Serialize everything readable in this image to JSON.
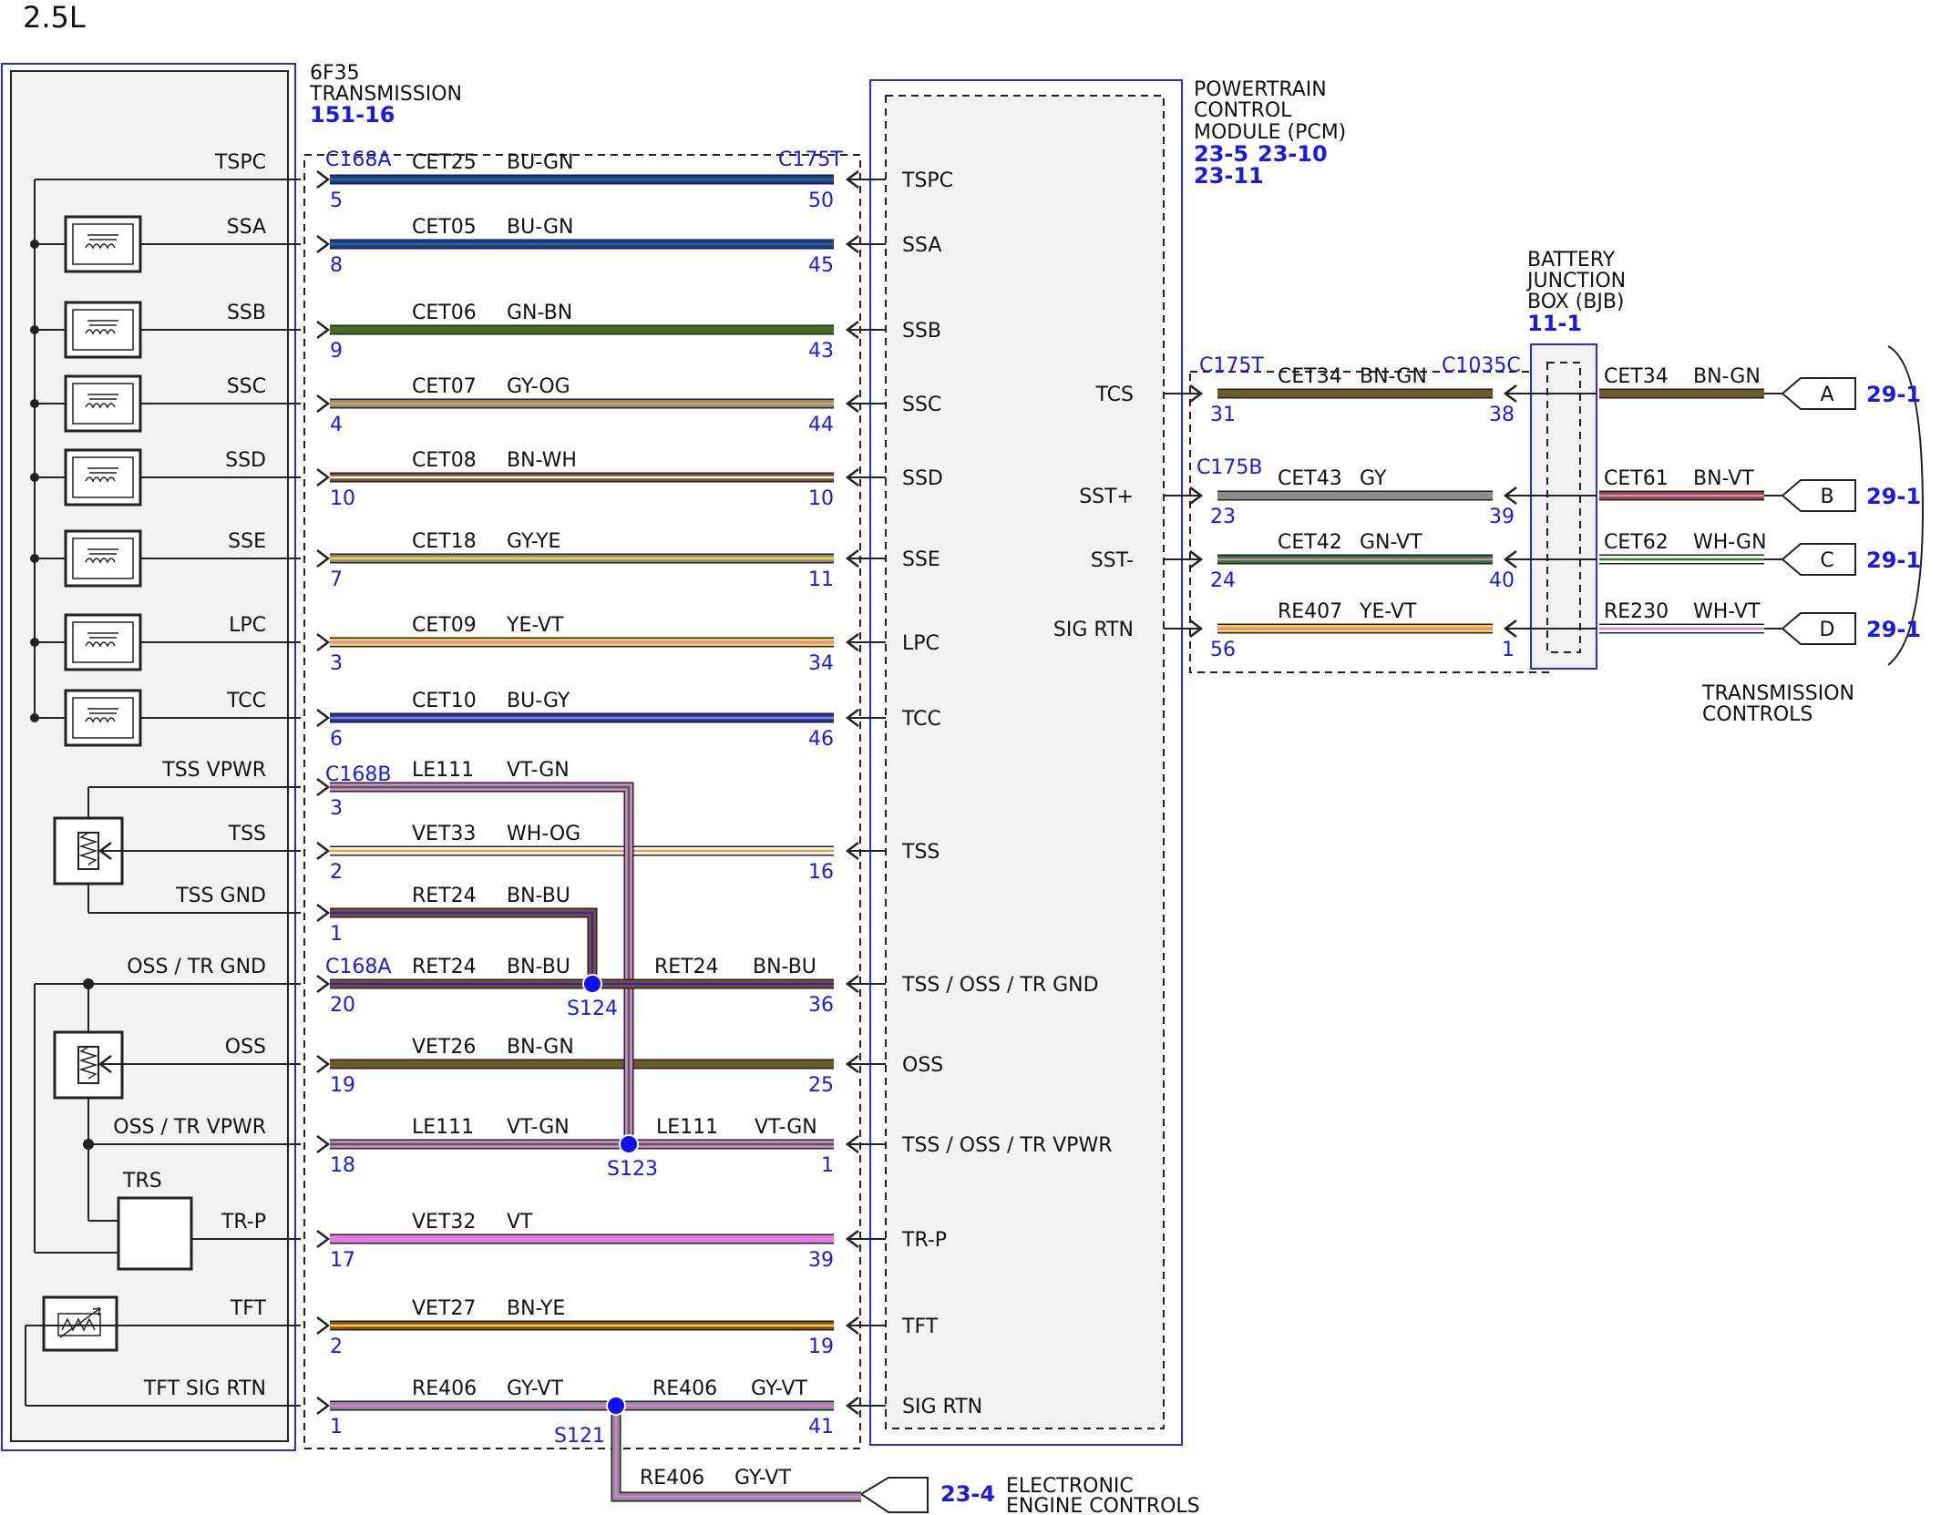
{
  "engine_label": "2.5L",
  "transmission": {
    "name_line1": "6F35",
    "name_line2": "TRANSMISSION",
    "ref": "151-16"
  },
  "pcm": {
    "line1": "POWERTRAIN",
    "line2": "CONTROL",
    "line3": "MODULE (PCM)",
    "ref1": "23-5",
    "ref2": "23-10",
    "ref3": "23-11"
  },
  "bjb": {
    "line1": "BATTERY",
    "line2": "JUNCTION",
    "line3": "BOX (BJB)",
    "ref": "11-1"
  },
  "transmission_controls": {
    "line1": "TRANSMISSION",
    "line2": "CONTROLS"
  },
  "electronic_engine_controls": {
    "ref": "23-4",
    "line1": "ELECTRONIC",
    "line2": "ENGINE CONTROLS"
  },
  "connectors": {
    "c168a_top": "C168A",
    "c175t_top": "C175T",
    "c168b": "C168B",
    "c168a_mid": "C168A",
    "c175t_right": "C175T",
    "c1035c": "C1035C",
    "c175b": "C175B"
  },
  "splices": {
    "s124": "S124",
    "s123": "S123",
    "s121": "S121"
  },
  "left_circuits": [
    {
      "left_label": "TSPC",
      "pin_left": "5",
      "circuit": "CET25",
      "color": "BU-GN",
      "pin_right": "50",
      "pcm_label": "TSPC"
    },
    {
      "left_label": "SSA",
      "pin_left": "8",
      "circuit": "CET05",
      "color": "BU-GN",
      "pin_right": "45",
      "pcm_label": "SSA"
    },
    {
      "left_label": "SSB",
      "pin_left": "9",
      "circuit": "CET06",
      "color": "GN-BN",
      "pin_right": "43",
      "pcm_label": "SSB"
    },
    {
      "left_label": "SSC",
      "pin_left": "4",
      "circuit": "CET07",
      "color": "GY-OG",
      "pin_right": "44",
      "pcm_label": "SSC"
    },
    {
      "left_label": "SSD",
      "pin_left": "10",
      "circuit": "CET08",
      "color": "BN-WH",
      "pin_right": "10",
      "pcm_label": "SSD"
    },
    {
      "left_label": "SSE",
      "pin_left": "7",
      "circuit": "CET18",
      "color": "GY-YE",
      "pin_right": "11",
      "pcm_label": "SSE"
    },
    {
      "left_label": "LPC",
      "pin_left": "3",
      "circuit": "CET09",
      "color": "YE-VT",
      "pin_right": "34",
      "pcm_label": "LPC"
    },
    {
      "left_label": "TCC",
      "pin_left": "6",
      "circuit": "CET10",
      "color": "BU-GY",
      "pin_right": "46",
      "pcm_label": "TCC"
    },
    {
      "left_label": "TSS VPWR",
      "pin_left": "3",
      "circuit": "LE111",
      "color": "VT-GN",
      "pin_right": "",
      "pcm_label": ""
    },
    {
      "left_label": "TSS",
      "pin_left": "2",
      "circuit": "VET33",
      "color": "WH-OG",
      "pin_right": "16",
      "pcm_label": "TSS"
    },
    {
      "left_label": "TSS GND",
      "pin_left": "1",
      "circuit": "RET24",
      "color": "BN-BU",
      "pin_right": "",
      "pcm_label": ""
    },
    {
      "left_label": "OSS / TR GND",
      "pin_left": "20",
      "circuit": "RET24",
      "color": "BN-BU",
      "circuit2": "RET24",
      "color2": "BN-BU",
      "pin_right": "36",
      "pcm_label": "TSS / OSS / TR GND"
    },
    {
      "left_label": "OSS",
      "pin_left": "19",
      "circuit": "VET26",
      "color": "BN-GN",
      "pin_right": "25",
      "pcm_label": "OSS"
    },
    {
      "left_label": "OSS / TR VPWR",
      "pin_left": "18",
      "circuit": "LE111",
      "color": "VT-GN",
      "circuit2": "LE111",
      "color2": "VT-GN",
      "pin_right": "1",
      "pcm_label": "TSS / OSS / TR VPWR"
    },
    {
      "left_label": "TR-P",
      "pin_left": "17",
      "circuit": "VET32",
      "color": "VT",
      "pin_right": "39",
      "pcm_label": "TR-P"
    },
    {
      "left_label": "TFT",
      "pin_left": "2",
      "circuit": "VET27",
      "color": "BN-YE",
      "pin_right": "19",
      "pcm_label": "TFT"
    },
    {
      "left_label": "TFT SIG RTN",
      "pin_left": "1",
      "circuit": "RE406",
      "color": "GY-VT",
      "circuit2": "RE406",
      "color2": "GY-VT",
      "pin_right": "41",
      "pcm_label": "SIG RTN"
    }
  ],
  "trs_label": "TRS",
  "bottom_branch": {
    "circuit": "RE406",
    "color": "GY-VT"
  },
  "right_circuits": [
    {
      "pcm_label": "TCS",
      "pin_left": "31",
      "circuit": "CET34",
      "color": "BN-GN",
      "pin_right": "38",
      "circuit2": "CET34",
      "color2": "BN-GN",
      "ref_letter": "A",
      "ref": "29-1"
    },
    {
      "pcm_label": "SST+",
      "pin_left": "23",
      "circuit": "CET43",
      "color": "GY",
      "pin_right": "39",
      "circuit2": "CET61",
      "color2": "BN-VT",
      "ref_letter": "B",
      "ref": "29-1"
    },
    {
      "pcm_label": "SST-",
      "pin_left": "24",
      "circuit": "CET42",
      "color": "GN-VT",
      "pin_right": "40",
      "circuit2": "CET62",
      "color2": "WH-GN",
      "ref_letter": "C",
      "ref": "29-1"
    },
    {
      "pcm_label": "SIG RTN",
      "pin_left": "56",
      "circuit": "RE407",
      "color": "YE-VT",
      "pin_right": "1",
      "circuit2": "RE230",
      "color2": "WH-VT",
      "ref_letter": "D",
      "ref": "29-1"
    }
  ],
  "colors": {
    "BU": "#1a2ec8",
    "GN": "#2a7a1e",
    "BN": "#8a4a2a",
    "GY": "#8c8c8c",
    "OG": "#e8a23a",
    "WH": "#ffffff",
    "YE": "#f2d72a",
    "VT": "#e07ae0",
    "outline": "#222222",
    "blue_text": "#1a1ae6",
    "splice": "#1010ee",
    "box_fill": "#f2f2f2",
    "box_border": "#2a2ae8"
  }
}
